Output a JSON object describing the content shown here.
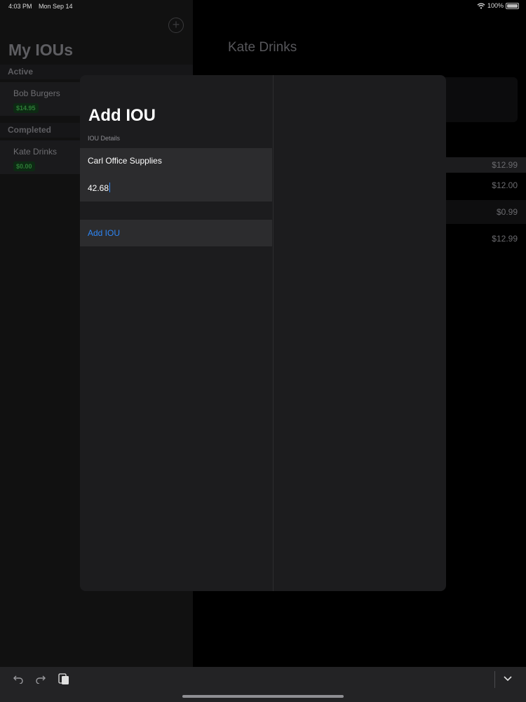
{
  "status_bar": {
    "time": "4:03 PM",
    "date": "Mon Sep 14",
    "battery": "100%"
  },
  "master": {
    "title": "My IOUs",
    "sections": [
      {
        "header": "Active",
        "items": [
          {
            "name": "Bob Burgers",
            "amount": "$14.95"
          }
        ]
      },
      {
        "header": "Completed",
        "items": [
          {
            "name": "Kate Drinks",
            "amount": "$0.00"
          }
        ]
      }
    ]
  },
  "detail": {
    "title": "Kate Drinks",
    "rows": [
      "$12.99",
      "$12.00",
      "$0.99",
      "$12.99"
    ]
  },
  "modal": {
    "title": "Add IOU",
    "section_caption": "IOU Details",
    "name_value": "Carl Office Supplies",
    "amount_value": "42.68",
    "add_button_label": "Add IOU"
  },
  "icons": {
    "add": "plus-circle-icon",
    "undo": "undo-icon",
    "redo": "redo-icon",
    "paste": "paste-icon",
    "dismiss_keyboard": "chevron-down-icon"
  },
  "colors": {
    "accent": "#2e86f5",
    "badge_green": "#2e7d37"
  }
}
